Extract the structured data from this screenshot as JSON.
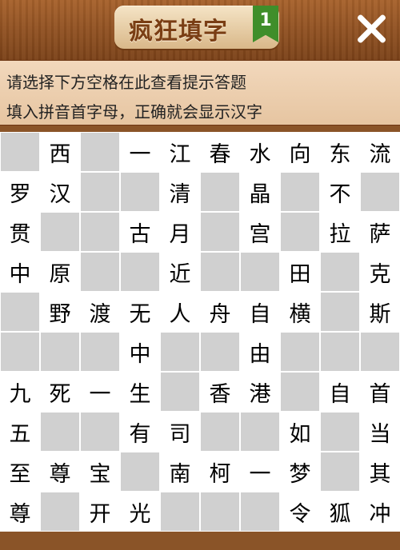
{
  "header": {
    "title": "疯狂填字",
    "level": "1",
    "close_icon": "close-icon"
  },
  "hint": {
    "line1": "请选择下方空格在此查看提示答题",
    "line2": "填入拼音首字母，正确就会显示汉字"
  },
  "grid": {
    "rows": [
      [
        "",
        "西",
        "",
        "一",
        "江",
        "春",
        "水",
        "向",
        "东",
        "流"
      ],
      [
        "罗",
        "汉",
        "",
        "",
        "清",
        "",
        "晶",
        "",
        "不",
        ""
      ],
      [
        "贯",
        "",
        "",
        "古",
        "月",
        "",
        "宫",
        "",
        "拉",
        "萨"
      ],
      [
        "中",
        "原",
        "",
        "",
        "近",
        "",
        "",
        "田",
        "",
        "克"
      ],
      [
        "",
        "野",
        "渡",
        "无",
        "人",
        "舟",
        "自",
        "横",
        "",
        "斯"
      ],
      [
        "",
        "",
        "",
        "中",
        "",
        "",
        "由",
        "",
        "",
        ""
      ],
      [
        "九",
        "死",
        "一",
        "生",
        "",
        "香",
        "港",
        "",
        "自",
        "首"
      ],
      [
        "五",
        "",
        "",
        "有",
        "司",
        "",
        "",
        "如",
        "",
        "当"
      ],
      [
        "至",
        "尊",
        "宝",
        "",
        "南",
        "柯",
        "一",
        "梦",
        "",
        "其"
      ],
      [
        "尊",
        "",
        "开",
        "光",
        "",
        "",
        "",
        "令",
        "狐",
        "冲"
      ]
    ],
    "types": [
      [
        "b",
        "f",
        "b",
        "f",
        "f",
        "f",
        "f",
        "f",
        "f",
        "f"
      ],
      [
        "f",
        "f",
        "b",
        "b",
        "f",
        "b",
        "f",
        "b",
        "f",
        "b"
      ],
      [
        "f",
        "b",
        "b",
        "f",
        "f",
        "b",
        "f",
        "b",
        "f",
        "f"
      ],
      [
        "f",
        "f",
        "b",
        "b",
        "f",
        "b",
        "b",
        "f",
        "b",
        "f"
      ],
      [
        "b",
        "f",
        "f",
        "f",
        "f",
        "f",
        "f",
        "f",
        "b",
        "f"
      ],
      [
        "b",
        "b",
        "b",
        "f",
        "b",
        "b",
        "f",
        "b",
        "b",
        "b"
      ],
      [
        "f",
        "f",
        "f",
        "f",
        "b",
        "f",
        "f",
        "b",
        "f",
        "f"
      ],
      [
        "f",
        "b",
        "b",
        "f",
        "f",
        "b",
        "b",
        "f",
        "b",
        "f"
      ],
      [
        "f",
        "f",
        "f",
        "b",
        "f",
        "f",
        "f",
        "f",
        "b",
        "f"
      ],
      [
        "f",
        "b",
        "f",
        "f",
        "b",
        "b",
        "b",
        "f",
        "f",
        "f"
      ]
    ]
  }
}
